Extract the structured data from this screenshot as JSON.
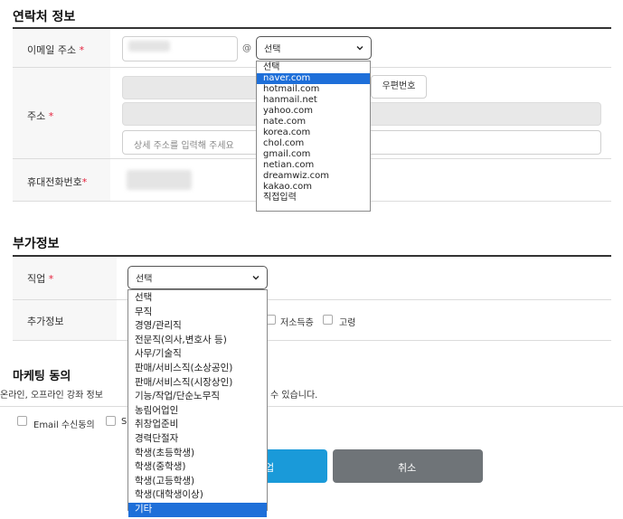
{
  "contact": {
    "title": "연락처 정보",
    "email_label": "이메일 주소",
    "required_mark": "*",
    "at_sign": "@",
    "email_domain_selected": "선택",
    "email_domain_options": [
      "선택",
      "naver.com",
      "hotmail.com",
      "hanmail.net",
      "yahoo.com",
      "nate.com",
      "korea.com",
      "chol.com",
      "gmail.com",
      "netian.com",
      "dreamwiz.com",
      "kakao.com",
      "직접입력"
    ],
    "address_label": "주소",
    "postcode_button": "우편번호",
    "detail_address_placeholder": "상세 주소를 입력해 주세요",
    "phone_label": "휴대전화번호"
  },
  "extra": {
    "title": "부가정보",
    "job_label": "직업",
    "job_selected": "선택",
    "job_options": [
      "선택",
      "무직",
      "경영/관리직",
      "전문직(의사,변호사 등)",
      "사무/기술직",
      "판매/서비스직(소상공인)",
      "판매/서비스직(시장상인)",
      "기능/작업/단순노무직",
      "농림어업인",
      "취창업준비",
      "경력단절자",
      "학생(초등학생)",
      "학생(중학생)",
      "학생(고등학생)",
      "학생(대학생이상)",
      "기타"
    ],
    "extra_info_label": "추가정보",
    "checkbox_low_income": "저소득층",
    "checkbox_elderly": "고령"
  },
  "marketing": {
    "title": "마케팅 동의",
    "desc_left": "온라인, 오프라인 강좌 정보",
    "desc_right": "수 있습니다.",
    "email_consent": "Email 수신동의",
    "sms_consent_partial": "S"
  },
  "actions": {
    "submit_partial": "업",
    "cancel": "취소"
  },
  "colors": {
    "selected_option_bg": "#1e6fd9",
    "required": "#e5213c",
    "submit_bg": "#1a9ad9",
    "cancel_bg": "#6f7478"
  }
}
